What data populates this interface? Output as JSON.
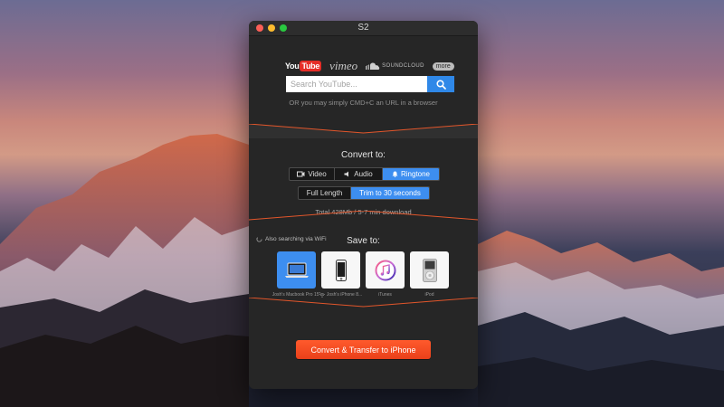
{
  "window": {
    "title": "S2"
  },
  "sources": {
    "youtube_you": "You",
    "youtube_tube": "Tube",
    "vimeo": "vimeo",
    "soundcloud": "SOUNDCLOUD",
    "more": "more"
  },
  "search": {
    "placeholder": "Search YouTube...",
    "value": "",
    "hint": "OR you may simply CMD+C an URL in a browser"
  },
  "convert": {
    "title": "Convert to:",
    "formats": [
      {
        "label": "Video",
        "icon": "film-icon",
        "active": false
      },
      {
        "label": "Audio",
        "icon": "speaker-icon",
        "active": false
      },
      {
        "label": "Ringtone",
        "icon": "bell-icon",
        "active": true
      }
    ],
    "length_options": [
      {
        "label": "Full Length",
        "active": false
      },
      {
        "label": "Trim to 30 seconds",
        "active": true
      }
    ],
    "total": "Total 428Mb / 5-7 min download"
  },
  "save": {
    "title": "Save to:",
    "wifi_note": "Also searching via WiFi",
    "devices": [
      {
        "label": "Josh's Macbook Pro 15\"",
        "icon": "macbook-icon",
        "active": true
      },
      {
        "label": "Josh's iPhone 8...",
        "icon": "iphone-icon",
        "active": false,
        "wifi": true
      },
      {
        "label": "iTunes",
        "icon": "itunes-icon",
        "active": false
      },
      {
        "label": "iPod",
        "icon": "ipod-icon",
        "active": false
      }
    ]
  },
  "action": {
    "label": "Convert & Transfer to iPhone"
  },
  "colors": {
    "accent": "#3d8ef0",
    "cta": "#f04a1f",
    "window_bg": "#262626"
  }
}
